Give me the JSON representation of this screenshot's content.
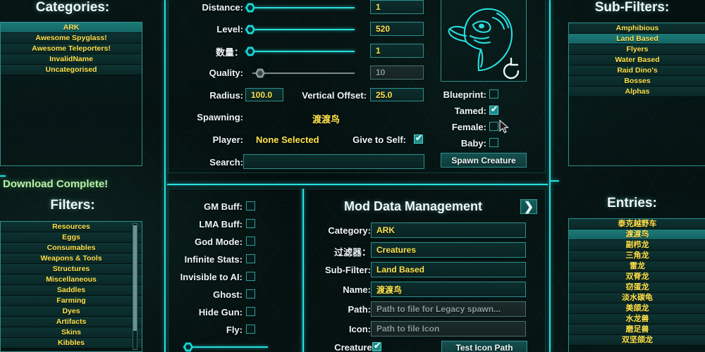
{
  "left_panel": {
    "categories_title": "Categories:",
    "categories": [
      {
        "label": "ARK",
        "selected": true
      },
      {
        "label": "Awesome Spyglass!",
        "selected": false
      },
      {
        "label": "Awesome Teleporters!",
        "selected": false
      },
      {
        "label": "InvalidName",
        "selected": false
      },
      {
        "label": "Uncategorised",
        "selected": false
      }
    ],
    "status_notice": "Download Complete!",
    "filters_title": "Filters:",
    "filters": [
      {
        "label": "Resources",
        "selected": false
      },
      {
        "label": "Eggs",
        "selected": false
      },
      {
        "label": "Consumables",
        "selected": false
      },
      {
        "label": "Weapons & Tools",
        "selected": false
      },
      {
        "label": "Structures",
        "selected": false
      },
      {
        "label": "Miscellaneous",
        "selected": false
      },
      {
        "label": "Saddles",
        "selected": false
      },
      {
        "label": "Farming",
        "selected": false
      },
      {
        "label": "Dyes",
        "selected": false
      },
      {
        "label": "Artifacts",
        "selected": false
      },
      {
        "label": "Skins",
        "selected": false
      },
      {
        "label": "Kibbles",
        "selected": false
      }
    ]
  },
  "spawn_controls": {
    "distance": {
      "label": "Distance:",
      "value": "1",
      "slider_pct": 2
    },
    "level": {
      "label": "Level:",
      "value": "520",
      "slider_pct": 2
    },
    "quantity": {
      "label": "数量：",
      "value": "1",
      "slider_pct": 2
    },
    "quality": {
      "label": "Quality:",
      "value": "10",
      "slider_pct": 4,
      "disabled": true
    },
    "radius": {
      "label": "Radius:",
      "value": "100.0"
    },
    "vertical_offset": {
      "label": "Vertical Offset:",
      "value": "25.0"
    },
    "spawning": {
      "label": "Spawning:",
      "value": "渡渡鸟"
    },
    "player": {
      "label": "Player:",
      "value": "None Selected"
    },
    "give_to_self": {
      "label": "Give to Self:",
      "checked": true
    },
    "search": {
      "label": "Search:",
      "value": "",
      "placeholder": ""
    }
  },
  "preview": {
    "icon_name": "dodo-creature-icon",
    "refresh_icon": "refresh-icon",
    "options": [
      {
        "label": "Blueprint:",
        "checked": false,
        "name": "blueprint"
      },
      {
        "label": "Tamed:",
        "checked": true,
        "name": "tamed"
      },
      {
        "label": "Female:",
        "checked": false,
        "name": "female"
      },
      {
        "label": "Baby:",
        "checked": false,
        "name": "baby"
      }
    ],
    "spawn_button": "Spawn Creature"
  },
  "sub_filters": {
    "title": "Sub-Filters:",
    "items": [
      {
        "label": "Amphibious",
        "selected": false
      },
      {
        "label": "Land Based",
        "selected": true
      },
      {
        "label": "Flyers",
        "selected": false
      },
      {
        "label": "Water Based",
        "selected": false
      },
      {
        "label": "Raid Dino's",
        "selected": false
      },
      {
        "label": "Bosses",
        "selected": false
      },
      {
        "label": "Alphas",
        "selected": false
      }
    ]
  },
  "entries": {
    "title": "Entries:",
    "items": [
      {
        "label": "泰克越野车",
        "selected": false
      },
      {
        "label": "渡渡鸟",
        "selected": true
      },
      {
        "label": "副栉龙",
        "selected": false
      },
      {
        "label": "三角龙",
        "selected": false
      },
      {
        "label": "雷龙",
        "selected": false
      },
      {
        "label": "双脊龙",
        "selected": false
      },
      {
        "label": "窃蛋龙",
        "selected": false
      },
      {
        "label": "淡水碳龟",
        "selected": false
      },
      {
        "label": "美颌龙",
        "selected": false
      },
      {
        "label": "水龙兽",
        "selected": false
      },
      {
        "label": "磨足兽",
        "selected": false
      },
      {
        "label": "双坚颌龙",
        "selected": false
      }
    ]
  },
  "cheats": {
    "items": [
      {
        "label": "GM Buff:",
        "checked": false,
        "name": "gm-buff"
      },
      {
        "label": "LMA Buff:",
        "checked": false,
        "name": "lma-buff"
      },
      {
        "label": "God Mode:",
        "checked": false,
        "name": "god-mode"
      },
      {
        "label": "Infinite Stats:",
        "checked": false,
        "name": "infinite-stats"
      },
      {
        "label": "Invisible to AI:",
        "checked": false,
        "name": "invisible-to-ai"
      },
      {
        "label": "Ghost:",
        "checked": false,
        "name": "ghost"
      },
      {
        "label": "Hide Gun:",
        "checked": false,
        "name": "hide-gun"
      },
      {
        "label": "Fly:",
        "checked": false,
        "name": "fly"
      }
    ],
    "bottom_slider_pct": 2
  },
  "mod_data": {
    "title": "Mod Data Management",
    "next_icon": "chevron-right-icon",
    "fields": [
      {
        "label": "Category:",
        "value": "ARK",
        "placeholder": "",
        "name": "category",
        "dim": false
      },
      {
        "label": "过滤器：",
        "value": "Creatures",
        "placeholder": "",
        "name": "filter",
        "dim": false
      },
      {
        "label": "Sub-Filter:",
        "value": "Land Based",
        "placeholder": "",
        "name": "sub-filter",
        "dim": false
      },
      {
        "label": "Name:",
        "value": "渡渡鸟",
        "placeholder": "",
        "name": "name",
        "dim": false
      },
      {
        "label": "Path:",
        "value": "",
        "placeholder": "Path to file for Legacy spawn...",
        "name": "path",
        "dim": true
      },
      {
        "label": "Icon:",
        "value": "",
        "placeholder": "Path to file Icon",
        "name": "icon",
        "dim": true
      }
    ],
    "creature_row": {
      "label": "Creature:",
      "checked": true
    },
    "test_icon_button": "Test Icon Path"
  },
  "colors": {
    "accent_cyan": "#26e2e2",
    "value_yellow": "#ffe44d",
    "selected_row": "#1c7b77",
    "notice_green": "#b8f2a8",
    "panel_border": "#2d8f8d"
  }
}
